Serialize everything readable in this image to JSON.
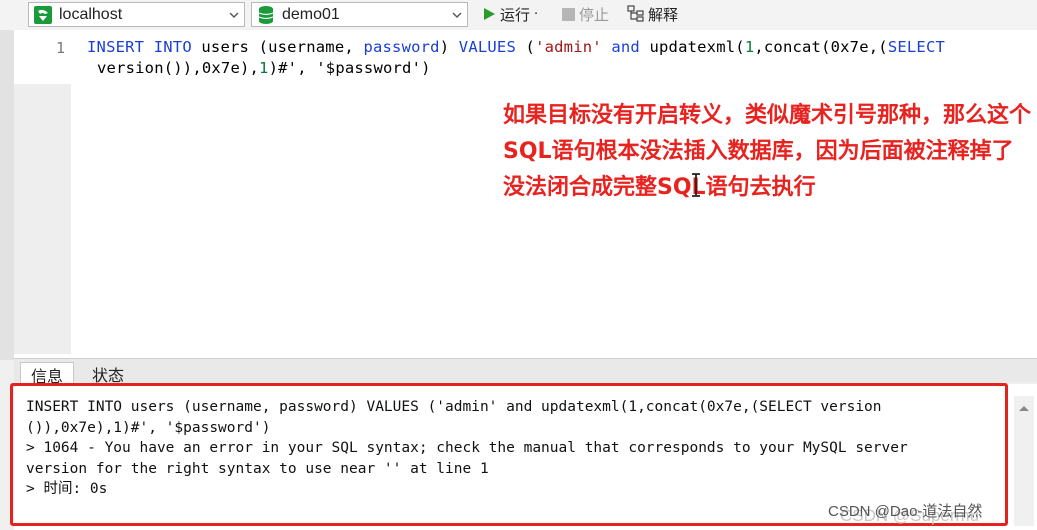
{
  "toolbar": {
    "connection": "localhost",
    "database": "demo01",
    "run_label": "运行",
    "run_dropdown": "·",
    "stop_label": "停止",
    "explain_label": "解释"
  },
  "editor": {
    "line_number": "1",
    "line1": {
      "t1": "INSERT INTO",
      "t2": " users (username, ",
      "t3": "password",
      "t4": ") ",
      "t5": "VALUES",
      "t6": " (",
      "t7": "'admin'",
      "t8": " ",
      "t9": "and",
      "t10": " updatexml(",
      "t11": "1",
      "t12": ",concat(0x7e,(",
      "t13": "SELECT"
    },
    "line2": {
      "t1": "version()),0x7e),",
      "t2": "1",
      "t3": ")#', '$password')"
    },
    "note": "如果目标没有开启转义，类似魔术引号那种，那么这个SQL语句根本没法插入数据库，因为后面被注释掉了 没法闭合成完整SQL语句去执行"
  },
  "tabs": {
    "info": "信息",
    "status": "状态"
  },
  "messages": {
    "line1": "INSERT INTO users (username, password) VALUES ('admin' and updatexml(1,concat(0x7e,(SELECT version",
    "line2": "()),0x7e),1)#', '$password')",
    "line3": "> 1064 - You have an error in your SQL syntax; check the manual that corresponds to your MySQL server",
    "line4": "version for the right syntax to use near '' at line 1",
    "line5": "> 时间: 0s"
  },
  "watermark": "CSDN @Dao-道法自然",
  "watermark_faint": "CSDN @Supermu"
}
